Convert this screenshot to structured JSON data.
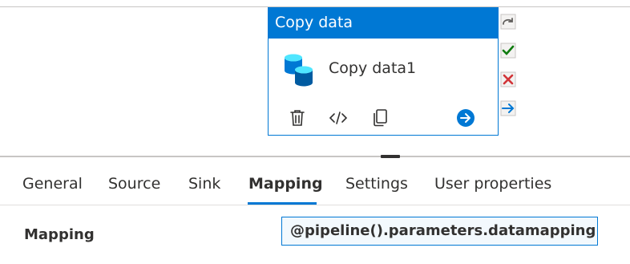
{
  "activity": {
    "type_title": "Copy data",
    "name": "Copy data1",
    "actions": [
      {
        "name": "delete-icon"
      },
      {
        "name": "code-icon"
      },
      {
        "name": "clone-icon"
      },
      {
        "name": "go-arrow-icon"
      }
    ]
  },
  "side_icons": [
    {
      "name": "skip-redo-icon"
    },
    {
      "name": "success-check-icon"
    },
    {
      "name": "failure-x-icon"
    },
    {
      "name": "completion-arrow-icon"
    }
  ],
  "tabs": [
    {
      "label": "General",
      "active": false
    },
    {
      "label": "Source",
      "active": false
    },
    {
      "label": "Sink",
      "active": false
    },
    {
      "label": "Mapping",
      "active": true
    },
    {
      "label": "Settings",
      "active": false
    },
    {
      "label": "User properties",
      "active": false
    }
  ],
  "mapping": {
    "label": "Mapping",
    "value": "@pipeline().parameters.datamapping"
  },
  "colors": {
    "accent": "#0078d4",
    "success": "#107c10",
    "failure": "#d13438"
  }
}
